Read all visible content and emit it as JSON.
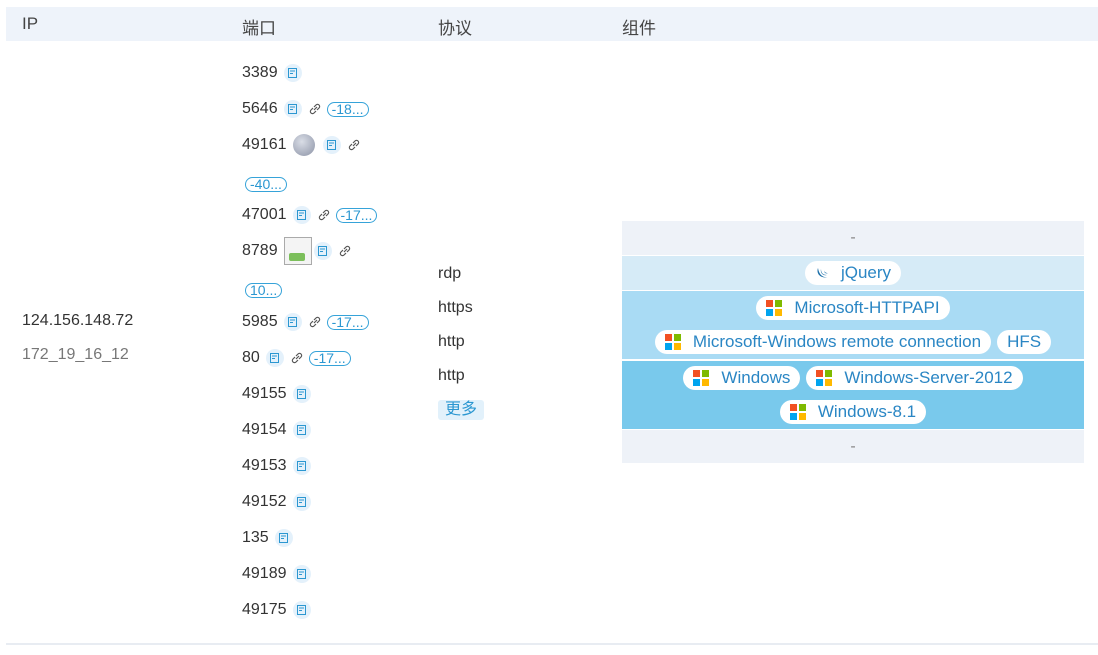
{
  "header": {
    "ip": "IP",
    "port": "端口",
    "protocol": "协议",
    "component": "组件"
  },
  "ip": {
    "primary": "124.156.148.72",
    "secondary": "172_19_16_12"
  },
  "ports": [
    {
      "number": "3389",
      "badge": ""
    },
    {
      "number": "5646",
      "badge": "-18..."
    },
    {
      "number": "49161",
      "badge": ""
    },
    {
      "number": "",
      "badge": "-40..."
    },
    {
      "number": "47001",
      "badge": "-17..."
    },
    {
      "number": "8789",
      "badge": ""
    },
    {
      "number": "",
      "badge": "10..."
    },
    {
      "number": "5985",
      "badge": "-17..."
    },
    {
      "number": "80",
      "badge": "-17..."
    },
    {
      "number": "49155",
      "badge": ""
    },
    {
      "number": "49154",
      "badge": ""
    },
    {
      "number": "49153",
      "badge": ""
    },
    {
      "number": "49152",
      "badge": ""
    },
    {
      "number": "135",
      "badge": ""
    },
    {
      "number": "49189",
      "badge": ""
    },
    {
      "number": "49175",
      "badge": ""
    }
  ],
  "protocols": [
    "rdp",
    "https",
    "http",
    "http"
  ],
  "more_label": "更多",
  "components": {
    "empty_top": "-",
    "empty_bottom": "-",
    "tags": [
      "jQuery",
      "Microsoft-HTTPAPI",
      "Microsoft-Windows remote connection",
      "HFS",
      "Windows",
      "Windows-Server-2012",
      "Windows-8.1"
    ],
    "colors": {
      "row_light": "#d6ebf7",
      "row_mid": "#a9dbf4",
      "row_dark": "#79c9ec",
      "row_empty": "#eef2f8"
    }
  }
}
